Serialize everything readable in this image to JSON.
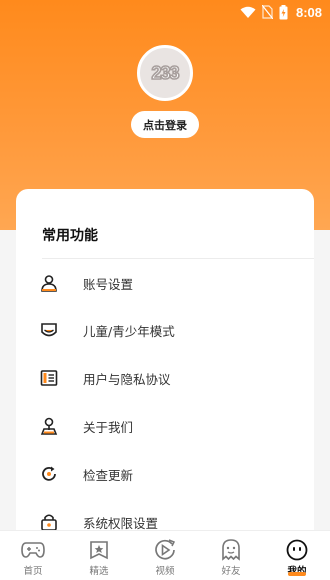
{
  "status_bar": {
    "time": "8:08"
  },
  "profile": {
    "avatar_text": "233",
    "login_label": "点击登录"
  },
  "section": {
    "title": "常用功能"
  },
  "menu": [
    {
      "label": "账号设置",
      "icon": "user-icon"
    },
    {
      "label": "儿童/青少年模式",
      "icon": "shield-icon"
    },
    {
      "label": "用户与隐私协议",
      "icon": "document-icon"
    },
    {
      "label": "关于我们",
      "icon": "pin-icon"
    },
    {
      "label": "检查更新",
      "icon": "refresh-icon"
    },
    {
      "label": "系统权限设置",
      "icon": "lock-icon"
    }
  ],
  "tabs": [
    {
      "label": "首页",
      "icon": "gamepad-icon"
    },
    {
      "label": "精选",
      "icon": "star-badge-icon"
    },
    {
      "label": "视频",
      "icon": "play-icon"
    },
    {
      "label": "好友",
      "icon": "ghost-icon"
    },
    {
      "label": "我的",
      "icon": "face-icon",
      "active": true
    }
  ],
  "colors": {
    "accent": "#ff8a1c",
    "icon_dark": "#222222"
  }
}
